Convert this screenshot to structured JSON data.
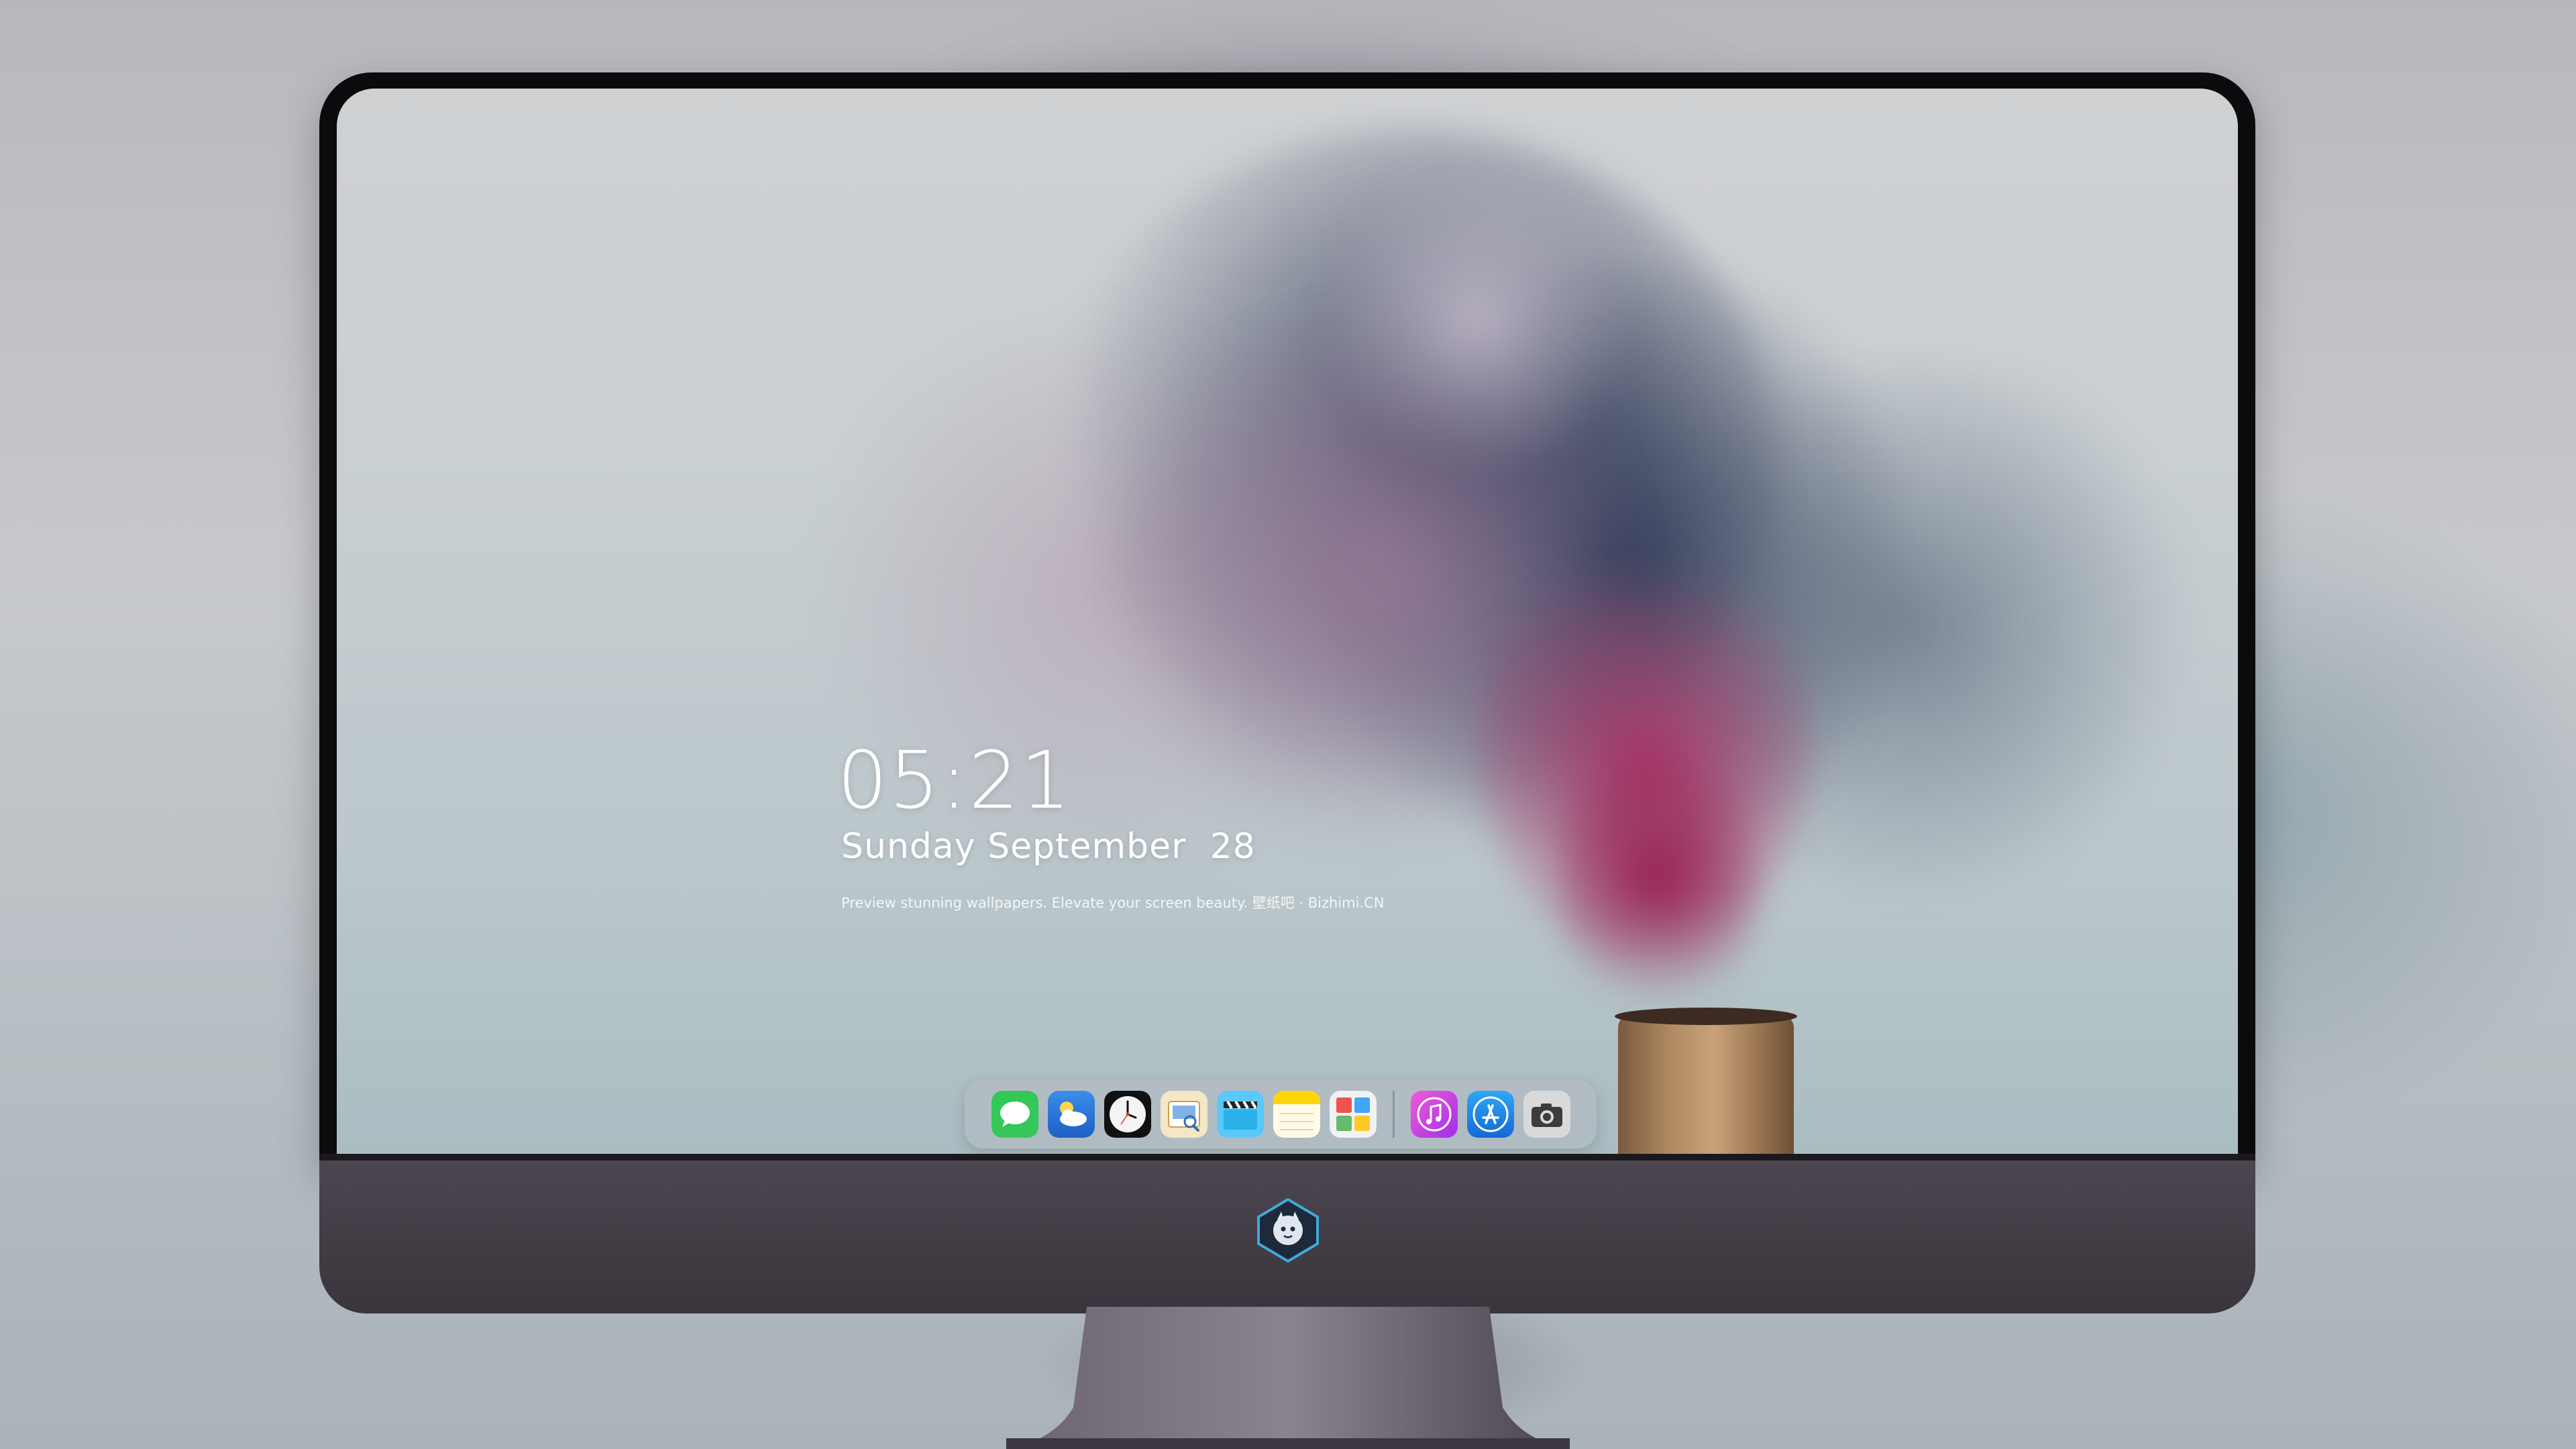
{
  "lockscreen": {
    "time": "05:21",
    "date": "Sunday September  28",
    "tagline": "Preview stunning wallpapers. Elevate your screen beauty. 壁纸吧 · Bizhimi.CN"
  },
  "dock": {
    "apps": [
      {
        "name": "Messages",
        "icon": "messages-icon",
        "color": "#34c759"
      },
      {
        "name": "Weather",
        "icon": "weather-icon",
        "color": "#2f7de1"
      },
      {
        "name": "Clock",
        "icon": "clock-icon",
        "color": "#111111"
      },
      {
        "name": "Preview",
        "icon": "preview-icon",
        "color": "#e9c46a"
      },
      {
        "name": "Final Cut",
        "icon": "clapperboard-icon",
        "color": "#5ac8fa"
      },
      {
        "name": "Notes",
        "icon": "notes-icon",
        "color": "#ffd60a"
      },
      {
        "name": "Photo Booth",
        "icon": "photo-grid-icon",
        "color": "#4caf50"
      },
      {
        "name": "iTunes",
        "icon": "music-icon",
        "color": "#d63cf0"
      },
      {
        "name": "App Store",
        "icon": "app-store-icon",
        "color": "#1e88e5"
      },
      {
        "name": "Camera",
        "icon": "camera-icon",
        "color": "#5a5a5a"
      }
    ]
  },
  "monitor": {
    "logo": "bizhimi-mascot-logo"
  }
}
